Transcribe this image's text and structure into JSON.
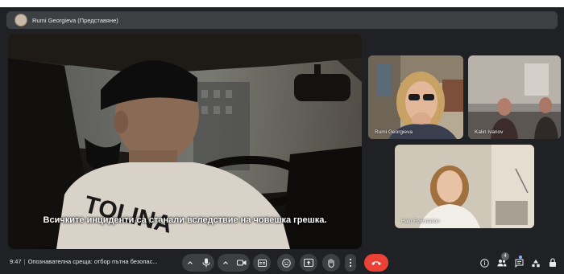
{
  "presenter": {
    "name": "Rumi Georgieva (Представяне)"
  },
  "stage": {
    "caption": "Всичките инциденти са станали вследствие на човешка грешка.",
    "jersey_text": "TOLINA"
  },
  "participants": [
    {
      "name": "Rumi Georgieva"
    },
    {
      "name": "Kalin Ivanov"
    },
    {
      "name": "Halo Foundation"
    }
  ],
  "toolbar": {
    "time": "9:47",
    "meeting_title": "Опознавателна среща: отбор пътна безопас...",
    "people_count": "4"
  },
  "colors": {
    "end_call": "#ea4335",
    "control_bg": "#3c4043",
    "background": "#202124"
  }
}
